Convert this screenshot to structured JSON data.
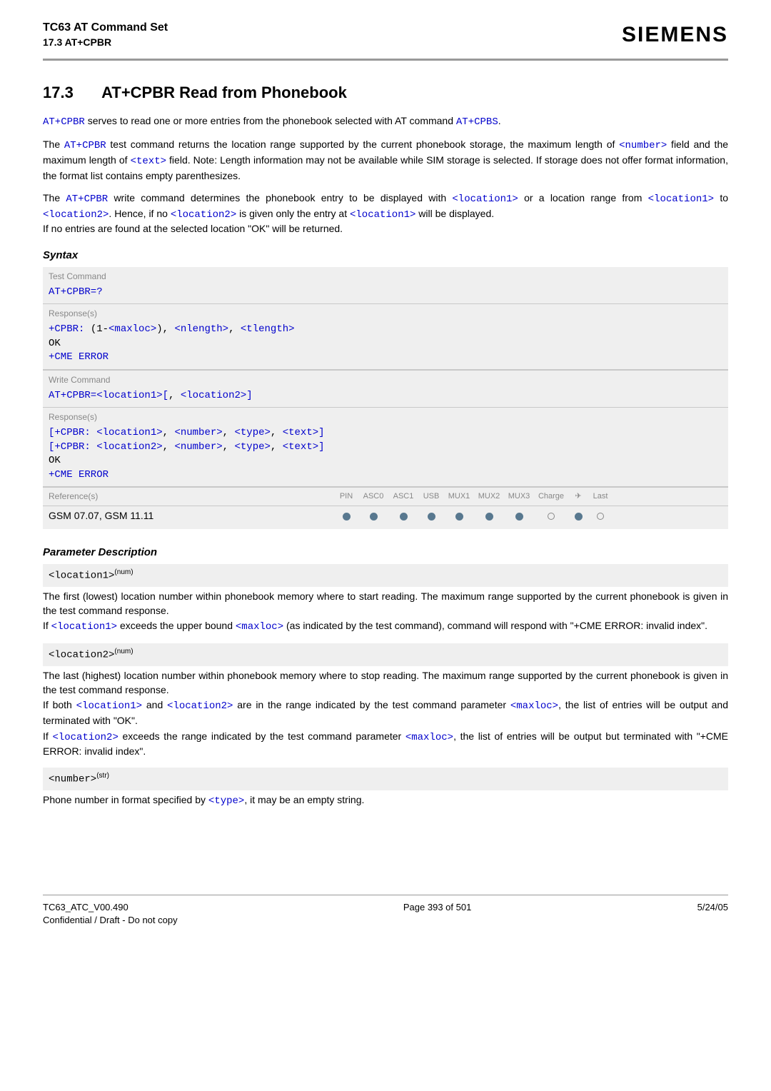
{
  "header": {
    "title_line1": "TC63 AT Command Set",
    "title_line2": "17.3 AT+CPBR",
    "brand": "SIEMENS"
  },
  "h1": {
    "num": "17.3",
    "title": "AT+CPBR   Read from Phonebook"
  },
  "intro1": {
    "cmd": "AT+CPBR",
    "text_mid": " serves to read one or more entries from the phonebook selected with AT command ",
    "cmd2": "AT+CPBS",
    "dot": "."
  },
  "intro2": {
    "t1": "The ",
    "cmd": "AT+CPBR",
    "t2": " test command returns the location range supported by the current phonebook storage, the maximum length of ",
    "number": "<number>",
    "t3": " field and the maximum length of ",
    "text": "<text>",
    "t4": " field. Note: Length information may not be available while SIM storage is selected. If storage does not offer format information, the format list contains empty parenthesizes."
  },
  "intro3": {
    "t1": "The ",
    "cmd": "AT+CPBR",
    "t2": " write command determines the phonebook entry to be displayed with ",
    "loc1": "<location1>",
    "t3": " or a location range from ",
    "loc1b": "<location1>",
    "t4": " to ",
    "loc2": "<location2>",
    "t5": ". Hence, if no ",
    "loc2b": "<location2>",
    "t6": " is given only the entry at ",
    "loc1c": "<location1>",
    "t7": " will be displayed.",
    "t8": "If no entries are found at the selected location \"OK\" will be returned."
  },
  "syntax_label": "Syntax",
  "labels": {
    "test": "Test Command",
    "responses": "Response(s)",
    "write": "Write Command",
    "refs": "Reference(s)"
  },
  "test_cmd": "AT+CPBR=?",
  "test_resp": {
    "pre": "+CPBR: ",
    "open": "(",
    "one": "1-",
    "maxloc": "<maxloc>",
    "close": ")",
    "comma1": ", ",
    "nlength": "<nlength>",
    "comma2": ", ",
    "tlength": "<tlength>",
    "ok": "OK",
    "cme": "+CME ERROR"
  },
  "write_cmd": {
    "pre": "AT+CPBR=",
    "loc1": "<location1>",
    "lb": "[",
    "comma": ", ",
    "loc2": "<location2>",
    "rb": "]"
  },
  "write_resp": {
    "lb": "[",
    "pre": "+CPBR: ",
    "loc1": "<location1>",
    "comma": ", ",
    "number": "<number>",
    "type": "<type>",
    "text": "<text>",
    "rb": "]",
    "loc2": "<location2>",
    "ok": "OK",
    "cme": "+CME ERROR"
  },
  "cols": [
    "PIN",
    "ASC0",
    "ASC1",
    "USB",
    "MUX1",
    "MUX2",
    "MUX3",
    "Charge",
    "✈",
    "Last"
  ],
  "gsm": "GSM 07.07, GSM 11.11",
  "paramdesc_label": "Parameter Description",
  "param1": {
    "name": "<location1>",
    "sup": "(num)",
    "p1": "The first (lowest) location number within phonebook memory where to start reading. The maximum range supported by the current phonebook is given in the test command response.",
    "p2a": "If ",
    "loc1": "<location1>",
    "p2b": " exceeds the upper bound ",
    "maxloc": "<maxloc>",
    "p2c": " (as indicated by the test command), command will respond with \"+CME ERROR: invalid index\"."
  },
  "param2": {
    "name": "<location2>",
    "sup": "(num)",
    "p1": "The last (highest) location number within phonebook memory where to stop reading. The maximum range supported by the current phonebook is given in the test command response.",
    "p2a": "If both ",
    "loc1": "<location1>",
    "p2b": " and ",
    "loc2": "<location2>",
    "p2c": " are in the range indicated by the test command parameter ",
    "maxloc": "<maxloc>",
    "p2d": ", the list of entries will be output and terminated with \"OK\".",
    "p3a": "If ",
    "loc2b": "<location2>",
    "p3b": " exceeds the range indicated by the test command parameter ",
    "maxlocb": "<maxloc>",
    "p3c": ", the list of entries will be output but terminated with \"+CME ERROR: invalid index\"."
  },
  "param3": {
    "name": "<number>",
    "sup": "(str)",
    "p1a": "Phone number in format specified by ",
    "type": "<type>",
    "p1b": ", it may be an empty string."
  },
  "footer": {
    "left1": "TC63_ATC_V00.490",
    "left2": "Confidential / Draft - Do not copy",
    "center": "Page 393 of 501",
    "right": "5/24/05"
  }
}
